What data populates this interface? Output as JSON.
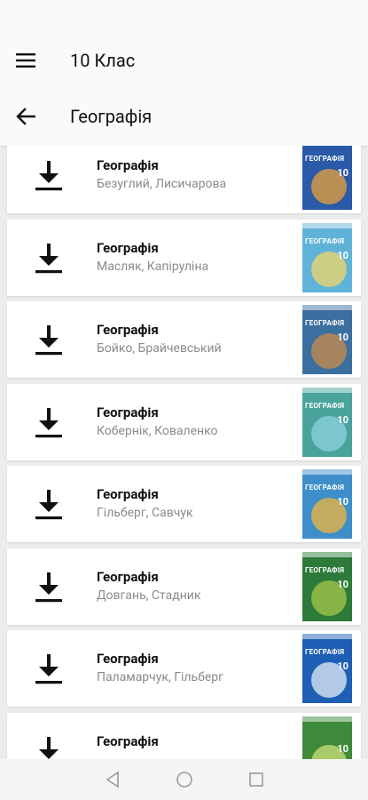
{
  "app_bar": {
    "title": "10 Клас",
    "menu_icon": "hamburger-menu-icon"
  },
  "sub_bar": {
    "title": "Географія",
    "back_icon": "arrow-back-icon"
  },
  "books": [
    {
      "title": "Географія",
      "authors": "Безуглий, Лисичарова",
      "cover_color": "#2a5aa8",
      "cover_accent": "#e8a33a",
      "cover_label": "Географія",
      "cover_num": "10"
    },
    {
      "title": "Географія",
      "authors": "Масляк, Капіруліна",
      "cover_color": "#5fb3d8",
      "cover_accent": "#f2d56a",
      "cover_label": "Географія",
      "cover_num": "10"
    },
    {
      "title": "Географія",
      "authors": "Бойко, Брайчевський",
      "cover_color": "#3b6fa0",
      "cover_accent": "#c98b4a",
      "cover_label": "Географія",
      "cover_num": "10"
    },
    {
      "title": "Географія",
      "authors": "Кобернік, Коваленко",
      "cover_color": "#4aa39a",
      "cover_accent": "#8ed1e0",
      "cover_label": "Географія",
      "cover_num": "10"
    },
    {
      "title": "Географія",
      "authors": "Гільберг, Савчук",
      "cover_color": "#3d8ec9",
      "cover_accent": "#f0b63d",
      "cover_label": "Географія",
      "cover_num": "10"
    },
    {
      "title": "Географія",
      "authors": "Довгань, Стадник",
      "cover_color": "#2d7a3a",
      "cover_accent": "#a5c84a",
      "cover_label": "Географія",
      "cover_num": "10"
    },
    {
      "title": "Географія",
      "authors": "Паламарчук, Гільберг",
      "cover_color": "#1e5fb5",
      "cover_accent": "#e6eef8",
      "cover_label": "Географія",
      "cover_num": "10"
    },
    {
      "title": "Географія",
      "authors": "",
      "cover_color": "#3f8a3a",
      "cover_accent": "#cfe07a",
      "cover_label": "",
      "cover_num": "10"
    }
  ],
  "nav": {
    "back": "nav-back-icon",
    "home": "nav-home-icon",
    "recents": "nav-recents-icon"
  }
}
